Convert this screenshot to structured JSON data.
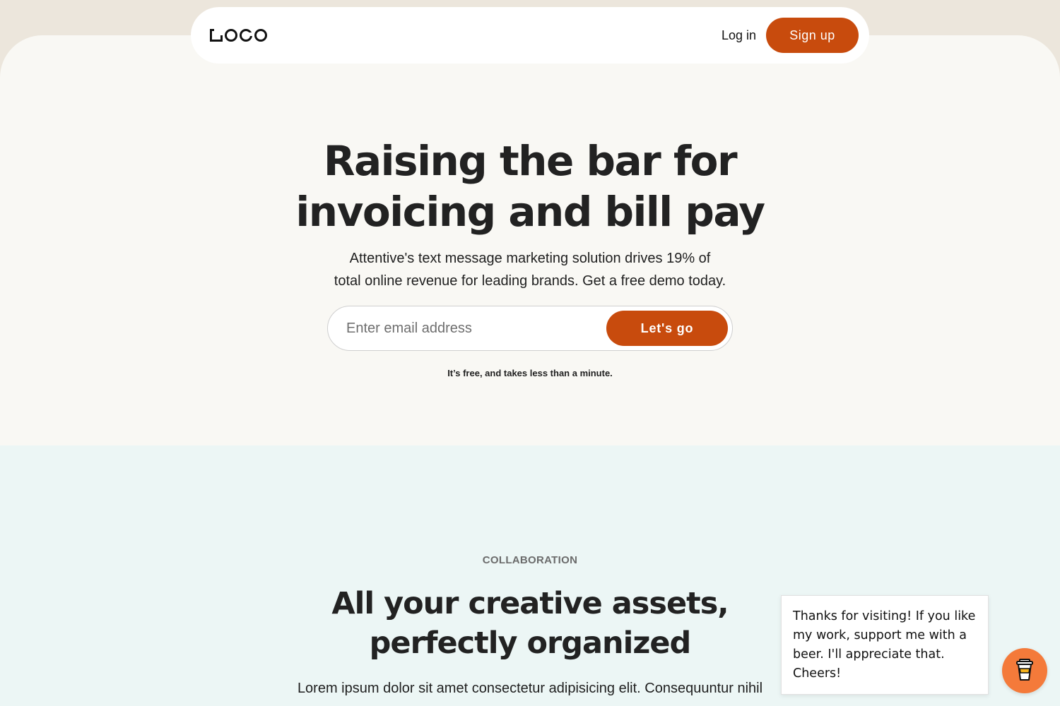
{
  "nav": {
    "logo_text": "LOGO",
    "login_label": "Log in",
    "signup_label": "Sign up"
  },
  "hero": {
    "title_line1": "Raising the bar for",
    "title_line2": "invoicing and bill pay",
    "subtitle_line1": "Attentive's text message marketing solution drives 19% of",
    "subtitle_line2": "total online revenue for leading brands. Get a free demo today.",
    "email_placeholder": "Enter email address",
    "cta_label": "Let's go",
    "note": "It’s free, and takes less than a minute."
  },
  "collaboration": {
    "eyebrow": "COLLABORATION",
    "title_line1": "All your creative assets,",
    "title_line2": "perfectly organized",
    "body": "Lorem ipsum dolor sit amet consectetur adipisicing elit. Consequuntur nihil"
  },
  "tip": {
    "text": "Thanks for visiting! If you like my work, support me with a beer. I'll appreciate that. Cheers!",
    "icon": "beer-cup-icon"
  },
  "colors": {
    "accent": "#c84b0d",
    "beer_button": "#f47a3a",
    "hero_bg": "#f9f8f4",
    "collab_bg": "#ecf6f5",
    "top_band": "#ece6dc"
  }
}
